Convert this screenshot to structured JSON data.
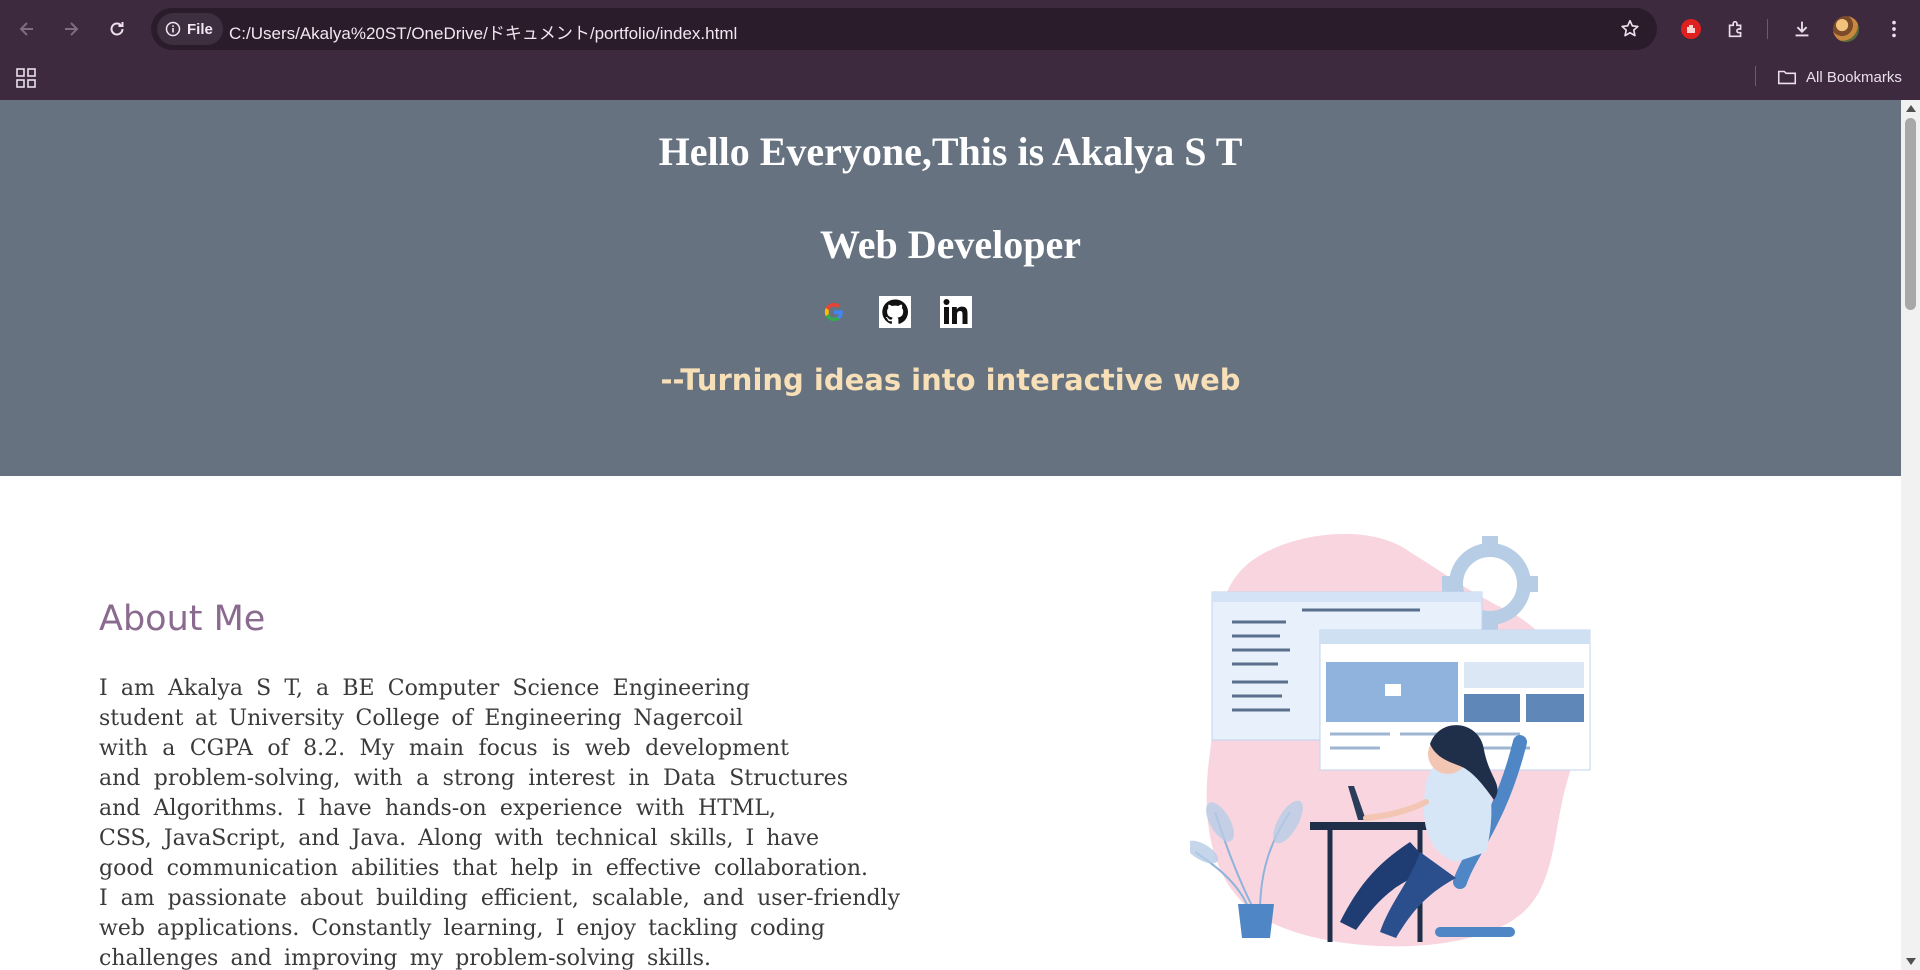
{
  "browser": {
    "file_chip_label": "File",
    "url": "C:/Users/Akalya%20ST/OneDrive/ドキュメント/portfolio/index.html",
    "bookmarks_label": "All Bookmarks"
  },
  "hero": {
    "title": "Hello Everyone,This is Akalya S T",
    "role": "Web Developer",
    "tagline": "--Turning ideas into interactive web",
    "socials": [
      "google-icon",
      "github-icon",
      "linkedin-icon"
    ]
  },
  "about": {
    "heading": "About Me",
    "lines": [
      "I am Akalya S T, a BE Computer Science Engineering",
      "student at University College of Engineering Nagercoil",
      "with a CGPA of 8.2. My main focus is web development",
      "and problem-solving, with a strong interest in Data Structures",
      "and Algorithms. I have hands-on experience with HTML,",
      "CSS, JavaScript, and Java. Along with technical skills, I have",
      "good communication abilities that help in effective collaboration.",
      "I am passionate about building efficient, scalable, and user-friendly",
      "web applications. Constantly learning, I enjoy tackling coding",
      "challenges and improving my problem-solving skills."
    ]
  },
  "colors": {
    "chrome_bg": "#3e2a3f",
    "hero_bg": "#667280",
    "tagline": "#f7dfb7",
    "about_heading": "#8a6a8e"
  }
}
